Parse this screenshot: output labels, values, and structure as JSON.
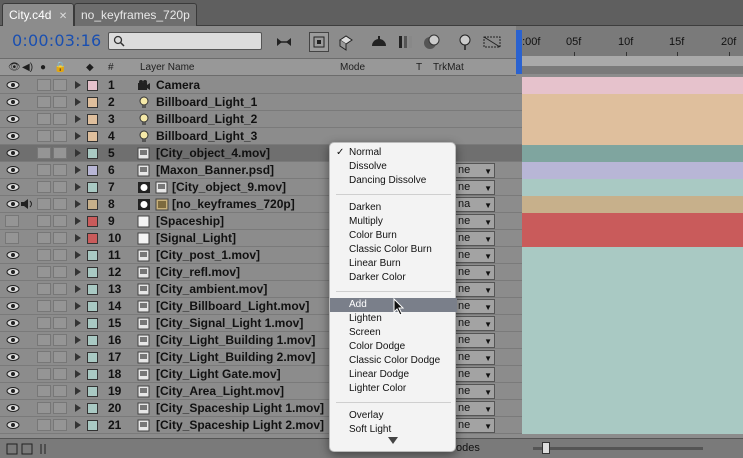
{
  "tabs": [
    {
      "label": "City.c4d",
      "close": "✕",
      "active": true
    },
    {
      "label": "no_keyframes_720p",
      "active": false
    }
  ],
  "timecode": "0:00:03:16",
  "search": {
    "placeholder": ""
  },
  "ruler": {
    "labels": [
      "0:00f",
      "05f",
      "10f",
      "15f",
      "20f"
    ]
  },
  "columns": {
    "layer_name": "Layer Name",
    "mode": "Mode",
    "t": "T",
    "trkmat": "TrkMat",
    "num": "#"
  },
  "colors": {
    "pink": "#e6c2cc",
    "peach": "#dfbf9d",
    "teal": "#a9c9c3",
    "lavender": "#b8b6d6",
    "tan": "#c7b08b",
    "red": "#c95b5b",
    "white": "#f4f4f4"
  },
  "layers": [
    {
      "num": "1",
      "name": "Camera",
      "label_color": "pink",
      "icon": "camera-icon",
      "eye": true,
      "mode": ""
    },
    {
      "num": "2",
      "name": "Billboard_Light_1",
      "label_color": "peach",
      "icon": "light-bulb-icon",
      "eye": true,
      "mode": ""
    },
    {
      "num": "3",
      "name": "Billboard_Light_2",
      "label_color": "peach",
      "icon": "light-bulb-icon",
      "eye": true,
      "mode": ""
    },
    {
      "num": "4",
      "name": "Billboard_Light_3",
      "label_color": "peach",
      "icon": "light-bulb-icon",
      "eye": true,
      "mode": ""
    },
    {
      "num": "5",
      "name": "[City_object_4.mov]",
      "label_color": "teal",
      "icon": "footage-icon",
      "eye": true,
      "mode": "",
      "selected": true
    },
    {
      "num": "6",
      "name": "[Maxon_Banner.psd]",
      "label_color": "lavender",
      "icon": "footage-icon",
      "eye": true,
      "mode": "ne"
    },
    {
      "num": "7",
      "name": "[City_object_9.mov]",
      "label_color": "teal",
      "icon": "footage-icon",
      "eye": true,
      "mode": "ne",
      "indent": true
    },
    {
      "num": "8",
      "name": "[no_keyframes_720p]",
      "label_color": "tan",
      "icon": "comp-icon",
      "eye": true,
      "audio": true,
      "mode": "na",
      "indent": true
    },
    {
      "num": "9",
      "name": "[Spaceship]",
      "label_color": "red",
      "icon": "solid-icon",
      "eye": false,
      "mode": "ne"
    },
    {
      "num": "10",
      "name": "[Signal_Light]",
      "label_color": "red",
      "icon": "solid-icon",
      "eye": false,
      "mode": "ne"
    },
    {
      "num": "11",
      "name": "[City_post_1.mov]",
      "label_color": "teal",
      "icon": "footage-icon",
      "eye": true,
      "mode": "ne"
    },
    {
      "num": "12",
      "name": "[City_refl.mov]",
      "label_color": "teal",
      "icon": "footage-icon",
      "eye": true,
      "mode": "ne"
    },
    {
      "num": "13",
      "name": "[City_ambient.mov]",
      "label_color": "teal",
      "icon": "footage-icon",
      "eye": true,
      "mode": "ne"
    },
    {
      "num": "14",
      "name": "[City_Billboard_Light.mov]",
      "label_color": "teal",
      "icon": "footage-icon",
      "eye": true,
      "mode": "ne"
    },
    {
      "num": "15",
      "name": "[City_Signal_Light 1.mov]",
      "label_color": "teal",
      "icon": "footage-icon",
      "eye": true,
      "mode": "ne"
    },
    {
      "num": "16",
      "name": "[City_Light_Building 1.mov]",
      "label_color": "teal",
      "icon": "footage-icon",
      "eye": true,
      "mode": "ne"
    },
    {
      "num": "17",
      "name": "[City_Light_Building 2.mov]",
      "label_color": "teal",
      "icon": "footage-icon",
      "eye": true,
      "mode": "ne"
    },
    {
      "num": "18",
      "name": "[City_Light Gate.mov]",
      "label_color": "teal",
      "icon": "footage-icon",
      "eye": true,
      "mode": "ne"
    },
    {
      "num": "19",
      "name": "[City_Area_Light.mov]",
      "label_color": "teal",
      "icon": "footage-icon",
      "eye": true,
      "mode": "ne"
    },
    {
      "num": "20",
      "name": "[City_Spaceship Light 1.mov]",
      "label_color": "teal",
      "icon": "footage-icon",
      "eye": true,
      "mode": "ne"
    },
    {
      "num": "21",
      "name": "[City_Spaceship Light 2.mov]",
      "label_color": "teal",
      "icon": "footage-icon",
      "eye": true,
      "mode": "ne"
    }
  ],
  "bottom": {
    "modes_label": "odes"
  },
  "mode_menu": {
    "checked": "Normal",
    "highlighted": "Add",
    "groups": [
      [
        "Normal",
        "Dissolve",
        "Dancing Dissolve"
      ],
      [
        "Darken",
        "Multiply",
        "Color Burn",
        "Classic Color Burn",
        "Linear Burn",
        "Darker Color"
      ],
      [
        "Add",
        "Lighten",
        "Screen",
        "Color Dodge",
        "Classic Color Dodge",
        "Linear Dodge",
        "Lighter Color"
      ],
      [
        "Overlay",
        "Soft Light"
      ]
    ]
  }
}
